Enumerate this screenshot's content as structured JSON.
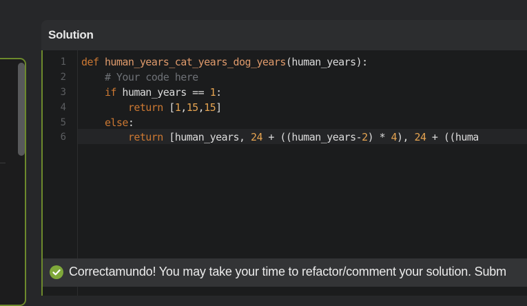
{
  "solution": {
    "title": "Solution",
    "line_numbers": [
      "1",
      "2",
      "3",
      "4",
      "5",
      "6"
    ],
    "code": {
      "l1": {
        "kw": "def",
        "fn": "human_years_cat_years_dog_years",
        "rest": "(human_years):"
      },
      "l2": {
        "indent": "    ",
        "comment": "# Your code here"
      },
      "l3": {
        "indent": "    ",
        "kw": "if",
        "mid": " human_years == ",
        "num": "1",
        "end": ":"
      },
      "l4": {
        "indent": "        ",
        "kw": "return",
        "a": " [",
        "n1": "1",
        ",1": ",",
        "n2": "15",
        ",2": ",",
        "n3": "15",
        "b": "]"
      },
      "l5": {
        "indent": "    ",
        "kw": "else",
        "end": ":"
      },
      "l6": {
        "indent": "        ",
        "kw": "return",
        "a": " [human_years, ",
        "n1": "24",
        "b": " + ((human_years-",
        "n2": "2",
        "c": ") * ",
        "n3": "4",
        "d": "), ",
        "n4": "24",
        "e": " + ((huma"
      }
    }
  },
  "banner": {
    "message": "Correctamundo! You may take your time to refactor/comment your solution. Subm",
    "icon": "check-circle-icon",
    "accent_color": "#7fa83a"
  }
}
